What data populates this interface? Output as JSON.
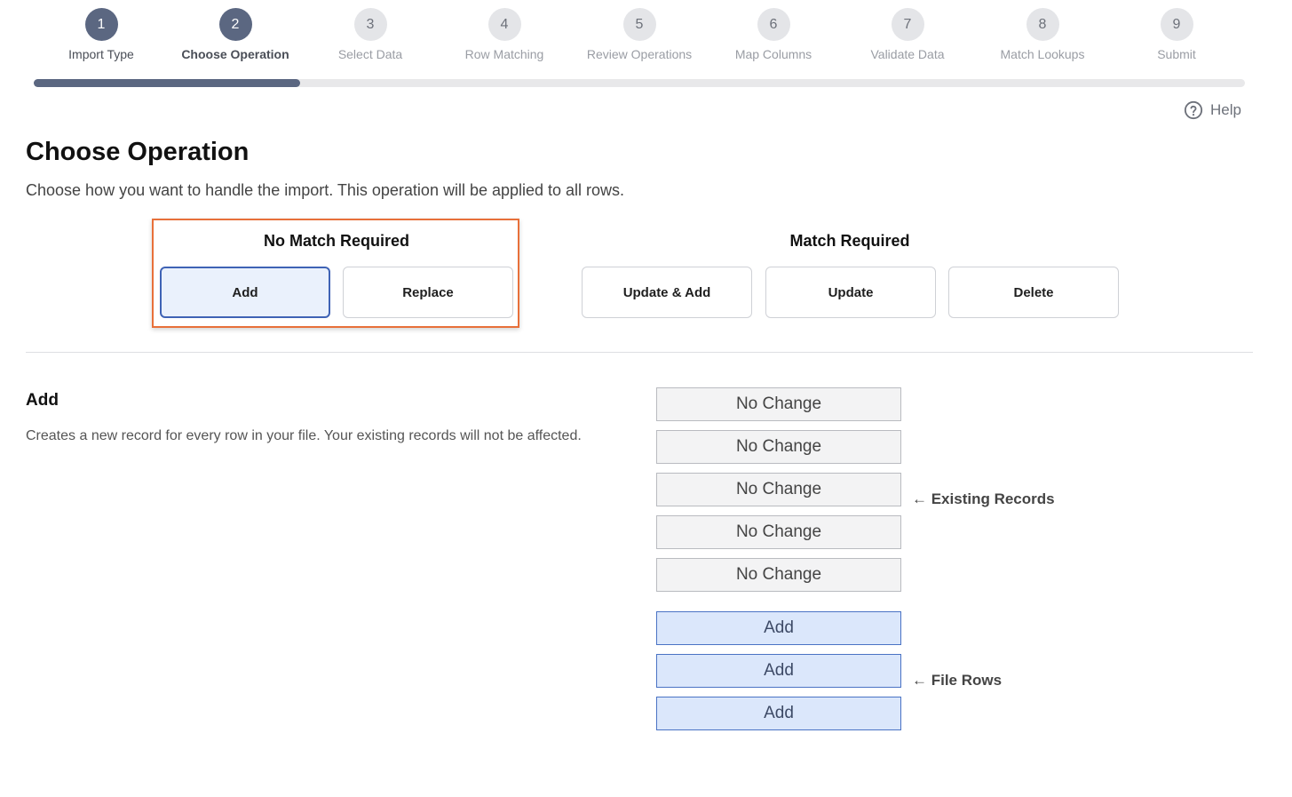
{
  "stepper": {
    "steps": [
      {
        "number": "1",
        "label": "Import Type"
      },
      {
        "number": "2",
        "label": "Choose Operation"
      },
      {
        "number": "3",
        "label": "Select Data"
      },
      {
        "number": "4",
        "label": "Row Matching"
      },
      {
        "number": "5",
        "label": "Review Operations"
      },
      {
        "number": "6",
        "label": "Map Columns"
      },
      {
        "number": "7",
        "label": "Validate Data"
      },
      {
        "number": "8",
        "label": "Match Lookups"
      },
      {
        "number": "9",
        "label": "Submit"
      }
    ],
    "current_step": 2,
    "progress_fraction": 0.22
  },
  "help": {
    "label": "Help",
    "icon": "question-circle-icon"
  },
  "page": {
    "title": "Choose Operation",
    "description": "Choose how you want to handle the import. This operation will be applied to all rows."
  },
  "operations": {
    "no_match": {
      "title": "No Match Required",
      "buttons": [
        "Add",
        "Replace"
      ]
    },
    "match": {
      "title": "Match Required",
      "buttons": [
        "Update & Add",
        "Update",
        "Delete"
      ]
    },
    "selected": "Add"
  },
  "detail": {
    "title": "Add",
    "description": "Creates a new record for every row in your file. Your existing records will not be affected.",
    "existing_rows": [
      "No Change",
      "No Change",
      "No Change",
      "No Change",
      "No Change"
    ],
    "file_rows": [
      "Add",
      "Add",
      "Add"
    ],
    "existing_label": "← Existing Records",
    "file_label": "← File Rows"
  },
  "colors": {
    "accent": "#5b6781",
    "selected_border": "#3f63b5",
    "highlight": "#e8703a",
    "file_row_bg": "#dbe7fb"
  }
}
